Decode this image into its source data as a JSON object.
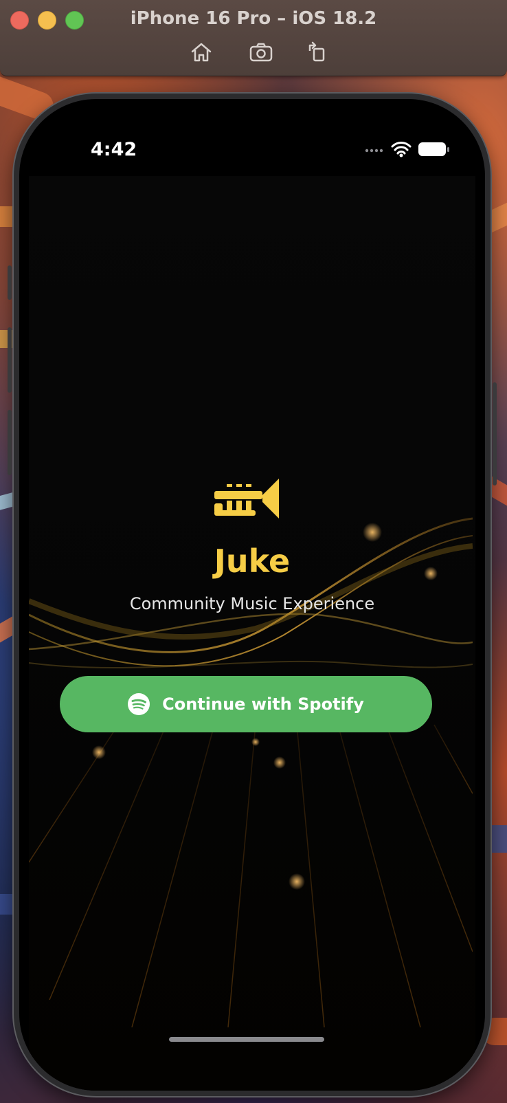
{
  "window": {
    "title": "iPhone 16 Pro – iOS 18.2",
    "toolbar": {
      "home_icon": "house-icon",
      "screenshot_icon": "camera-icon",
      "rotate_icon": "rotate-icon"
    }
  },
  "status_bar": {
    "time": "4:42",
    "icons": [
      "signal-dots-icon",
      "wifi-icon",
      "battery-icon"
    ]
  },
  "main": {
    "logo_icon": "trumpet-icon",
    "title": "Juke",
    "subtitle": "Community Music Experience",
    "cta": {
      "label": "Continue with Spotify",
      "icon": "spotify-icon"
    }
  },
  "colors": {
    "accent_gold": "#f6cd46",
    "spotify_green": "#57b762",
    "background": "#000000"
  }
}
